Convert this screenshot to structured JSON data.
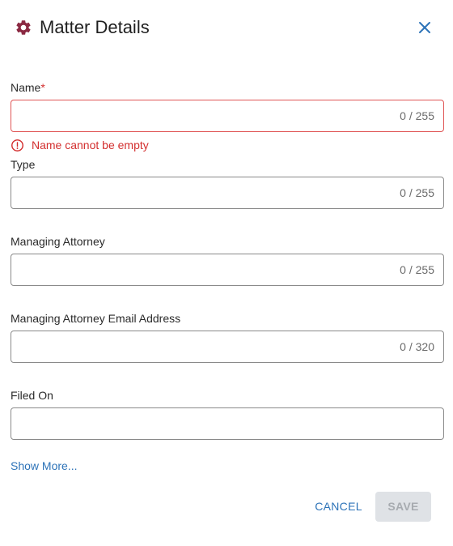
{
  "header": {
    "icon": "gear-icon",
    "title": "Matter Details",
    "close_icon": "close-icon"
  },
  "fields": {
    "name": {
      "label": "Name",
      "required_marker": "*",
      "value": "",
      "counter": "0 / 255",
      "error": "Name cannot be empty",
      "error_icon": "alert-circle-icon"
    },
    "type": {
      "label": "Type",
      "value": "",
      "counter": "0 / 255"
    },
    "managing_attorney": {
      "label": "Managing Attorney",
      "value": "",
      "counter": "0 / 255"
    },
    "managing_attorney_email": {
      "label": "Managing Attorney Email Address",
      "value": "",
      "counter": "0 / 320"
    },
    "filed_on": {
      "label": "Filed On",
      "value": ""
    }
  },
  "links": {
    "show_more": "Show More..."
  },
  "actions": {
    "cancel": "CANCEL",
    "save": "SAVE"
  },
  "colors": {
    "brand_icon": "#8b2942",
    "accent": "#2d73b8",
    "error": "#d32f2f",
    "disabled_bg": "#dfe2e6",
    "disabled_text": "#a7abb0"
  }
}
